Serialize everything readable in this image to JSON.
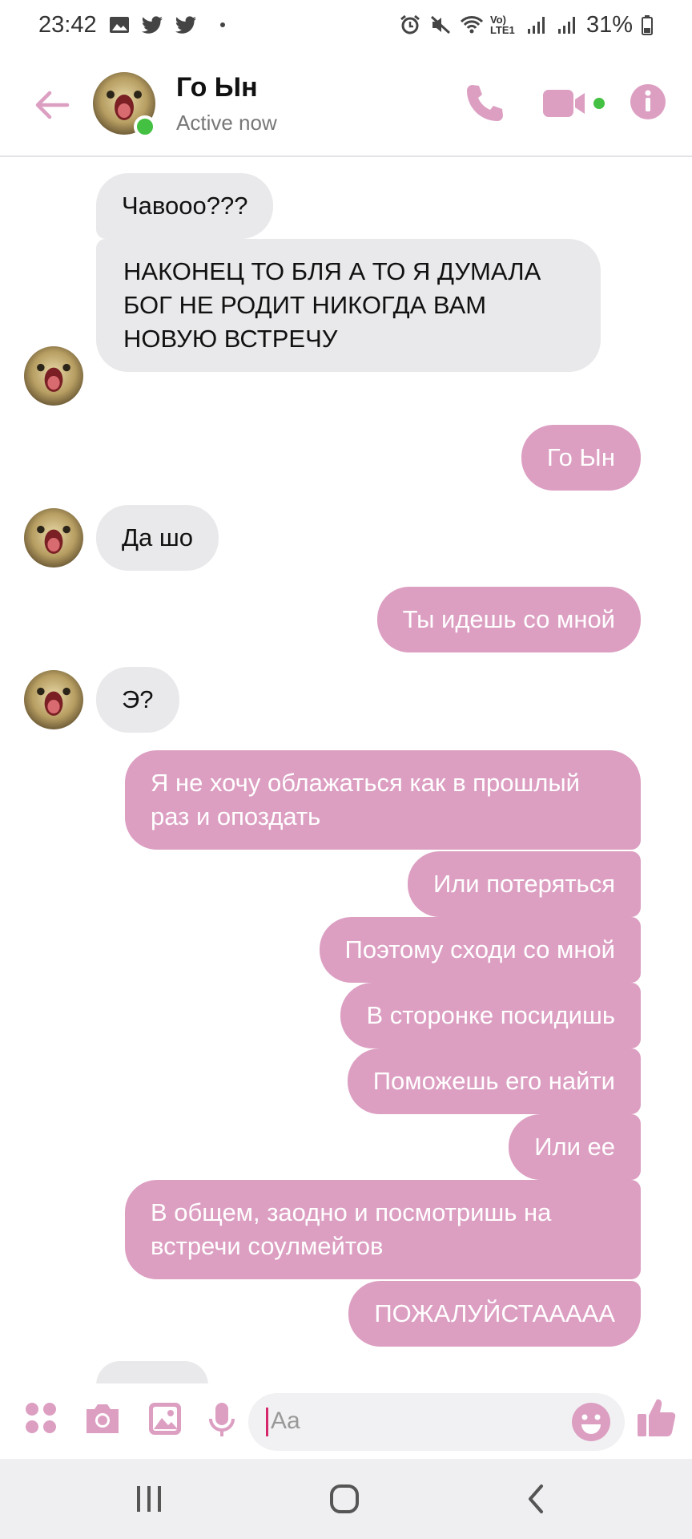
{
  "status_bar": {
    "time": "23:42",
    "battery": "31%",
    "network": "Vo) LTE1",
    "left_icons": [
      "gallery-icon",
      "twitter-icon",
      "twitter-icon"
    ],
    "right_icons": [
      "alarm-icon",
      "mute-icon",
      "wifi-icon",
      "signal-icon",
      "signal-icon",
      "battery-icon"
    ]
  },
  "header": {
    "contact_name": "Го Ын",
    "status": "Active now",
    "accent_color": "#dc9fc2",
    "online_color": "#44c042"
  },
  "messages": [
    {
      "side": "in",
      "text": "Чавооо???"
    },
    {
      "side": "in",
      "text": "НАКОНЕЦ ТО БЛЯ А ТО Я ДУМАЛА БОГ НЕ РОДИТ НИКОГДА ВАМ НОВУЮ ВСТРЕЧУ"
    },
    {
      "side": "out",
      "text": "Го Ын"
    },
    {
      "side": "in",
      "text": "Да шо"
    },
    {
      "side": "out",
      "text": "Ты идешь со мной"
    },
    {
      "side": "in",
      "text": "Э?"
    },
    {
      "side": "out",
      "text": "Я не хочу облажаться как в прошлый раз и опоздать"
    },
    {
      "side": "out",
      "text": "Или потеряться"
    },
    {
      "side": "out",
      "text": "Поэтому сходи со мной"
    },
    {
      "side": "out",
      "text": "В сторонке посидишь"
    },
    {
      "side": "out",
      "text": "Поможешь его найти"
    },
    {
      "side": "out",
      "text": "Или ее"
    },
    {
      "side": "out",
      "text": "В общем, заодно и посмотришь на встречи соулмейтов"
    },
    {
      "side": "out",
      "text": "ПОЖАЛУЙСТААААА"
    }
  ],
  "composer": {
    "placeholder": "Aa",
    "icons": [
      "apps-icon",
      "camera-icon",
      "image-icon",
      "mic-icon",
      "emoji-icon",
      "thumbs-up-icon"
    ]
  },
  "nav_bar": {
    "buttons": [
      "recents-icon",
      "home-icon",
      "back-nav-icon"
    ]
  }
}
